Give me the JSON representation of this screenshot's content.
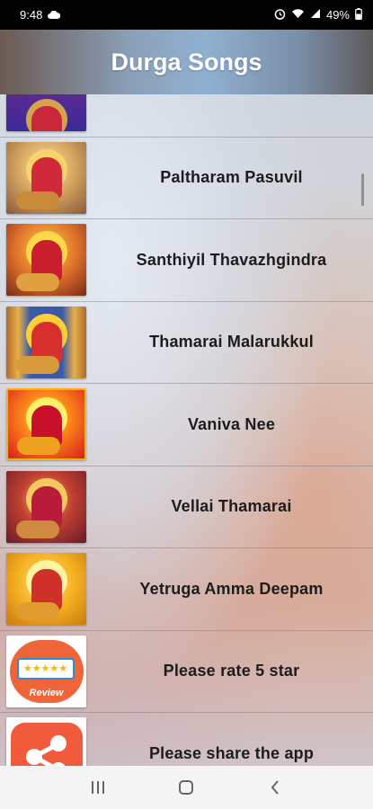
{
  "status_bar": {
    "time": "9:48",
    "battery": "49%",
    "icons": [
      "cloud-icon",
      "alarm-icon",
      "wifi-icon",
      "signal-icon",
      "battery-icon"
    ]
  },
  "app_bar": {
    "title": "Durga Songs"
  },
  "songs": [
    {
      "title": "",
      "thumb": "durga-thumb-partial"
    },
    {
      "title": "Paltharam Pasuvil",
      "thumb": "durga-thumb-1"
    },
    {
      "title": "Santhiyil Thavazhgindra",
      "thumb": "durga-thumb-2"
    },
    {
      "title": "Thamarai Malarukkul",
      "thumb": "durga-thumb-3"
    },
    {
      "title": "Vaniva Nee",
      "thumb": "durga-thumb-4"
    },
    {
      "title": "Vellai Thamarai",
      "thumb": "durga-thumb-5"
    },
    {
      "title": "Yetruga Amma Deepam",
      "thumb": "durga-thumb-6"
    },
    {
      "title": "Please rate 5 star",
      "thumb": "review-icon"
    },
    {
      "title": "Please share the app",
      "thumb": "share-icon"
    }
  ],
  "review_badge": {
    "stars": "★★★★★",
    "label": "Review"
  },
  "nav_bar": {
    "recents": "|||",
    "home": "○",
    "back": "<"
  },
  "colors": {
    "app_bar_accent": "#8fb0d0",
    "review_orange": "#f0643a",
    "share_orange": "#f15a3a"
  }
}
